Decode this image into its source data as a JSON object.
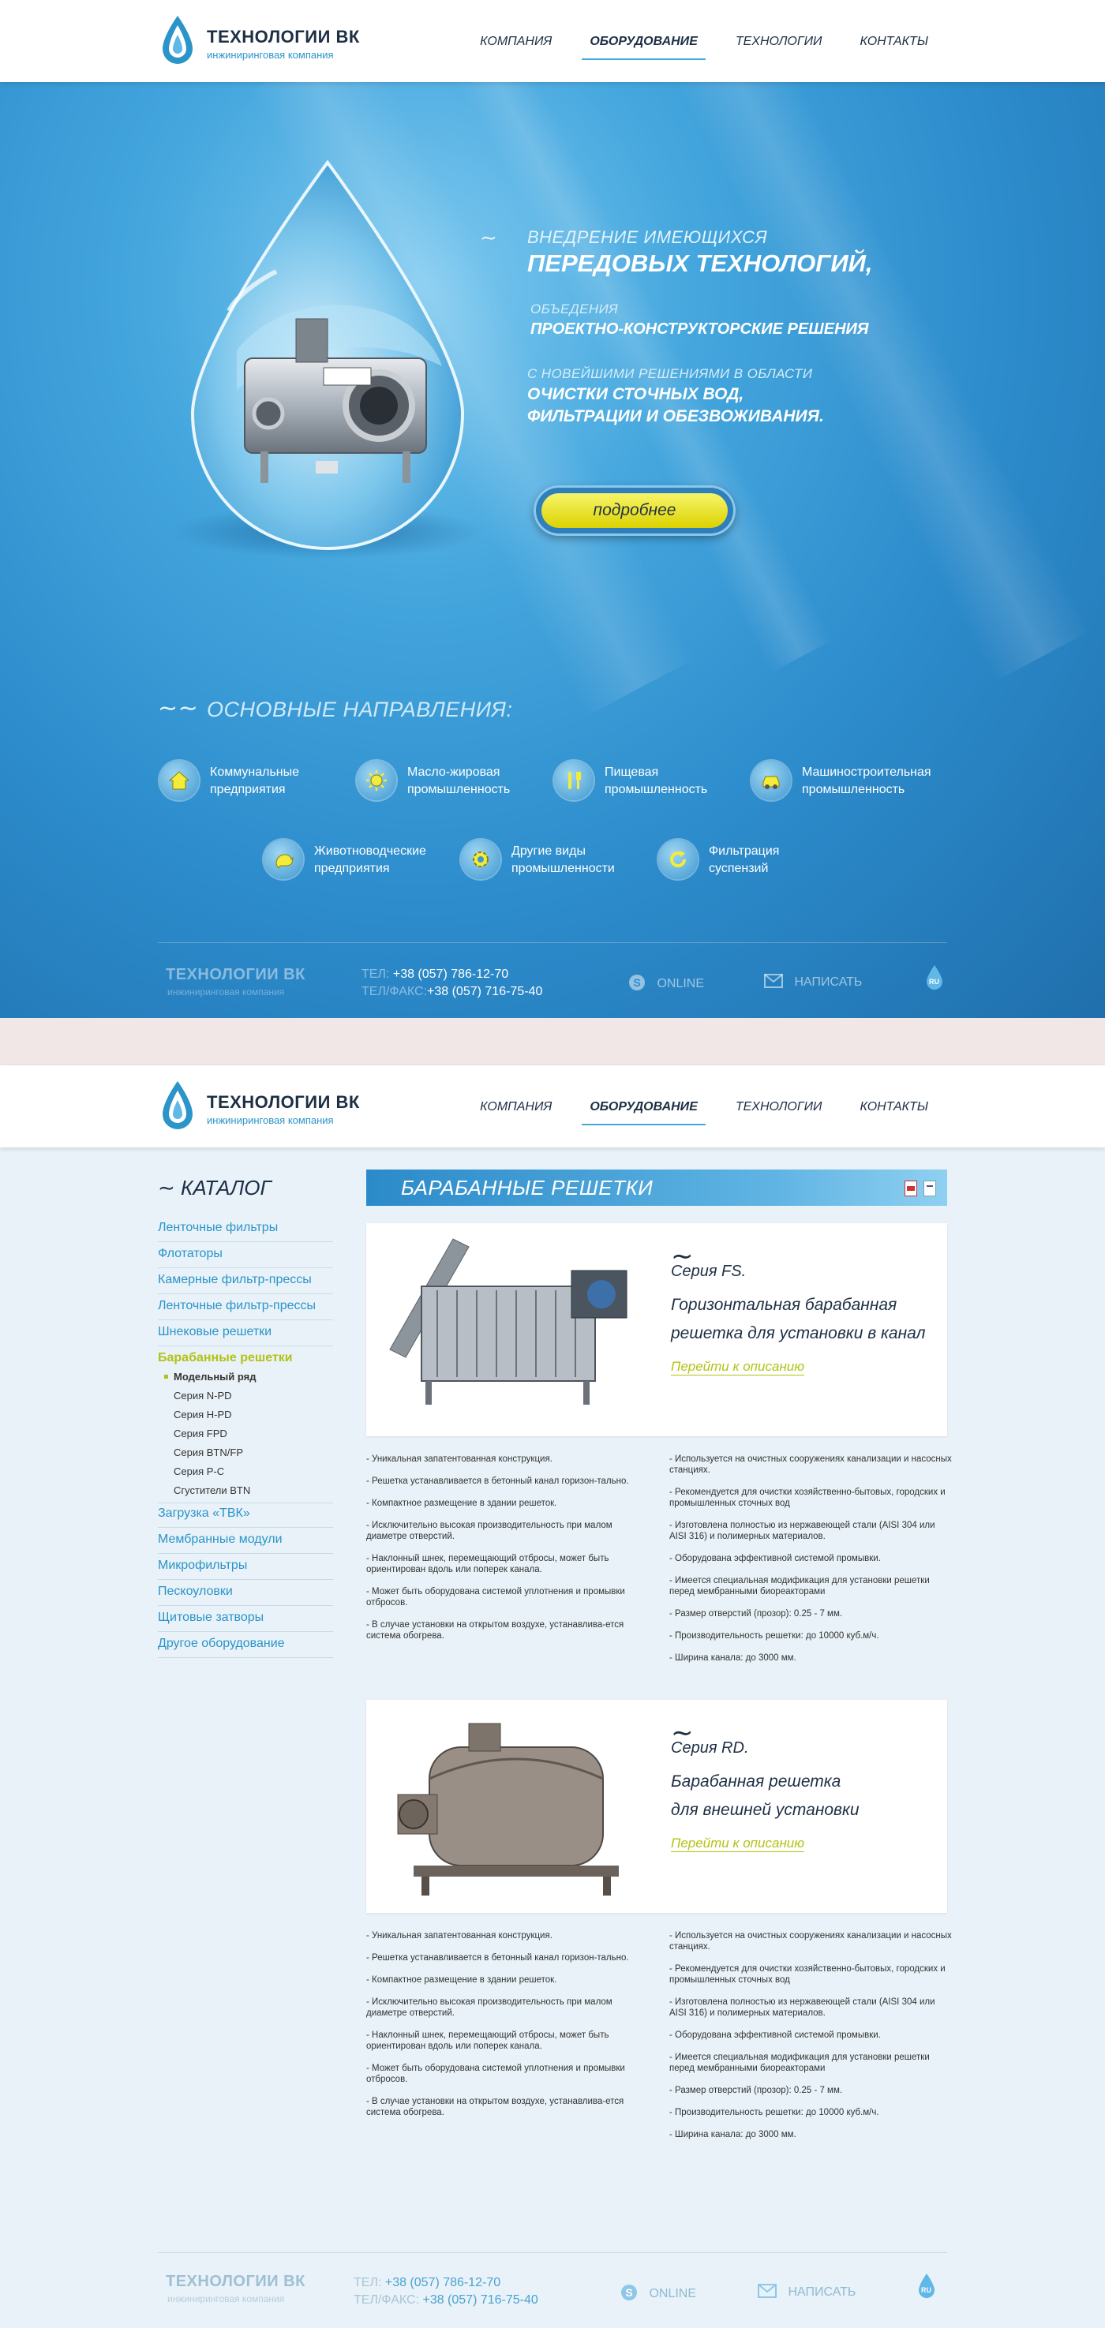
{
  "header": {
    "brand": "ТЕХНОЛОГИИ ВК",
    "brand_sub": "инжиниринговая компания",
    "nav": [
      "КОМПАНИЯ",
      "ОБОРУДОВАНИЕ",
      "ТЕХНОЛОГИИ",
      "КОНТАКТЫ"
    ],
    "active_nav": "ОБОРУДОВАНИЕ"
  },
  "hero": {
    "line1": "ВНЕДРЕНИЕ ИМЕЮЩИХСЯ",
    "line2": "ПЕРЕДОВЫХ ТЕХНОЛОГИЙ,",
    "line3": "ОБЪЕДЕНИЯ",
    "line4": "ПРОЕКТНО-КОНСТРУКТОРСКИЕ РЕШЕНИЯ",
    "line5": "С НОВЕЙШИМИ РЕШЕНИЯМИ В ОБЛАСТИ",
    "line6": "ОЧИСТКИ СТОЧНЫХ ВОД,",
    "line7": "ФИЛЬТРАЦИИ И ОБЕЗВОЖИВАНИЯ.",
    "more_button": "подробнее"
  },
  "directions": {
    "title": "ОСНОВНЫЕ НАПРАВЛЕНИЯ:",
    "items": [
      {
        "line1": "Коммунальные",
        "line2": "предприятия",
        "icon": "house-icon"
      },
      {
        "line1": "Масло-жировая",
        "line2": "промышленность",
        "icon": "sun-icon"
      },
      {
        "line1": "Пищевая",
        "line2": "промышленность",
        "icon": "cutlery-icon"
      },
      {
        "line1": "Машиностроительная",
        "line2": "промышленность",
        "icon": "car-icon"
      },
      {
        "line1": "Животноводческие",
        "line2": "предприятия",
        "icon": "animal-icon"
      },
      {
        "line1": "Другие виды",
        "line2": "промышленности",
        "icon": "gear-icon"
      },
      {
        "line1": "Фильтрация",
        "line2": "суспензий",
        "icon": "refresh-icon"
      }
    ]
  },
  "footer": {
    "brand": "ТЕХНОЛОГИИ ВК",
    "brand_sub": "инжиниринговая компания",
    "tel_label": "ТЕЛ:",
    "tel": "+38 (057) 786-12-70",
    "fax_label": "ТЕЛ/ФАКС:",
    "fax": "+38 (057) 716-75-40",
    "online": "ONLINE",
    "write": "НАПИСАТЬ",
    "lang": "RU"
  },
  "catalog": {
    "title": "КАТАЛОГ",
    "items": [
      "Ленточные фильтры",
      "Флотаторы",
      "Камерные фильтр-прессы",
      "Ленточные фильтр-прессы",
      "Шнековые решетки",
      "Барабанные решетки"
    ],
    "sub_items": [
      "Модельный ряд",
      "Серия N-PD",
      "Серия H-PD",
      "Серия FPD",
      "Серия BTN/FP",
      "Серия P-C",
      "Сгустители BTN"
    ],
    "items_after": [
      "Загрузка «ТВК»",
      "Мембранные модули",
      "Микрофильтры",
      "Пескоуловки",
      "Щитовые затворы",
      "Другое оборудование"
    ]
  },
  "section": {
    "title": "БАРАБАННЫЕ РЕШЕТКИ"
  },
  "products": [
    {
      "series": "Серия FS.",
      "desc1": "Горизонтальная барабанная",
      "desc2": "решетка для установки в канал",
      "link": "Перейти к описанию"
    },
    {
      "series": "Серия RD.",
      "desc1": "Барабанная решетка",
      "desc2": "для внешней установки",
      "link": "Перейти к описанию"
    }
  ],
  "features_left": [
    "- Уникальная запатентованная конструкция.",
    "- Решетка устанавливается в бетонный канал горизон-тально.",
    "- Компактное размещение в здании решеток.",
    "- Исключительно высокая производительность при малом диаметре отверстий.",
    "- Наклонный шнек, перемещающий отбросы, может быть ориентирован вдоль или поперек канала.",
    "- Может быть оборудована системой уплотнения и промывки отбросов.",
    "- В случае установки на открытом воздухе, устанавлива-ется система обогрева."
  ],
  "features_right": [
    "- Используется на очистных сооружениях канализации и насосных станциях.",
    "- Рекомендуется для очистки хозяйственно-бытовых, городских и промышленных сточных вод",
    "- Изготовлена полностью из нержавеющей стали (AISI 304 или AISI 316) и полимерных материалов.",
    "- Оборудована эффективной системой промывки.",
    "- Имеется специальная модификация для установки решетки перед мембранными биореакторами",
    "- Размер отверстий (прозор): 0.25 - 7 мм.",
    "- Производительность решетки: до 10000 куб.м/ч.",
    "- Ширина канала: до 3000 мм."
  ],
  "colors": {
    "accent": "#2b94c9",
    "lime": "#b3c214",
    "dark": "#1d2f44",
    "button": "#f0ec3a"
  }
}
